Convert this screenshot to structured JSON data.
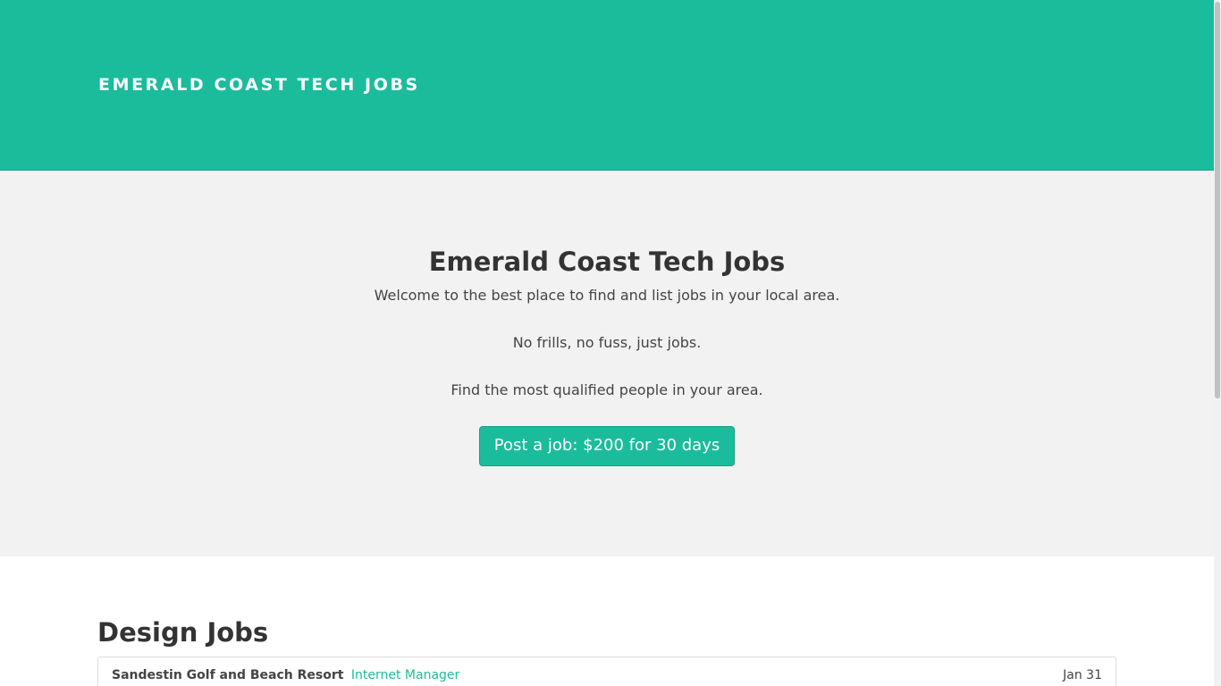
{
  "header": {
    "brand": "EMERALD COAST TECH JOBS"
  },
  "hero": {
    "title": "Emerald Coast Tech Jobs",
    "lines": [
      "Welcome to the best place to find and list jobs in your local area.",
      "No frills, no fuss, just jobs.",
      "Find the most qualified people in your area."
    ],
    "button_label": "Post a job: $200 for 30 days"
  },
  "sections": [
    {
      "title": "Design Jobs",
      "jobs": [
        {
          "company": "Sandestin Golf and Beach Resort",
          "title": "Internet Manager",
          "date": "Jan 31"
        }
      ]
    }
  ],
  "colors": {
    "accent": "#1abc9c",
    "hero_bg": "#f2f2f2",
    "text": "#333333"
  }
}
